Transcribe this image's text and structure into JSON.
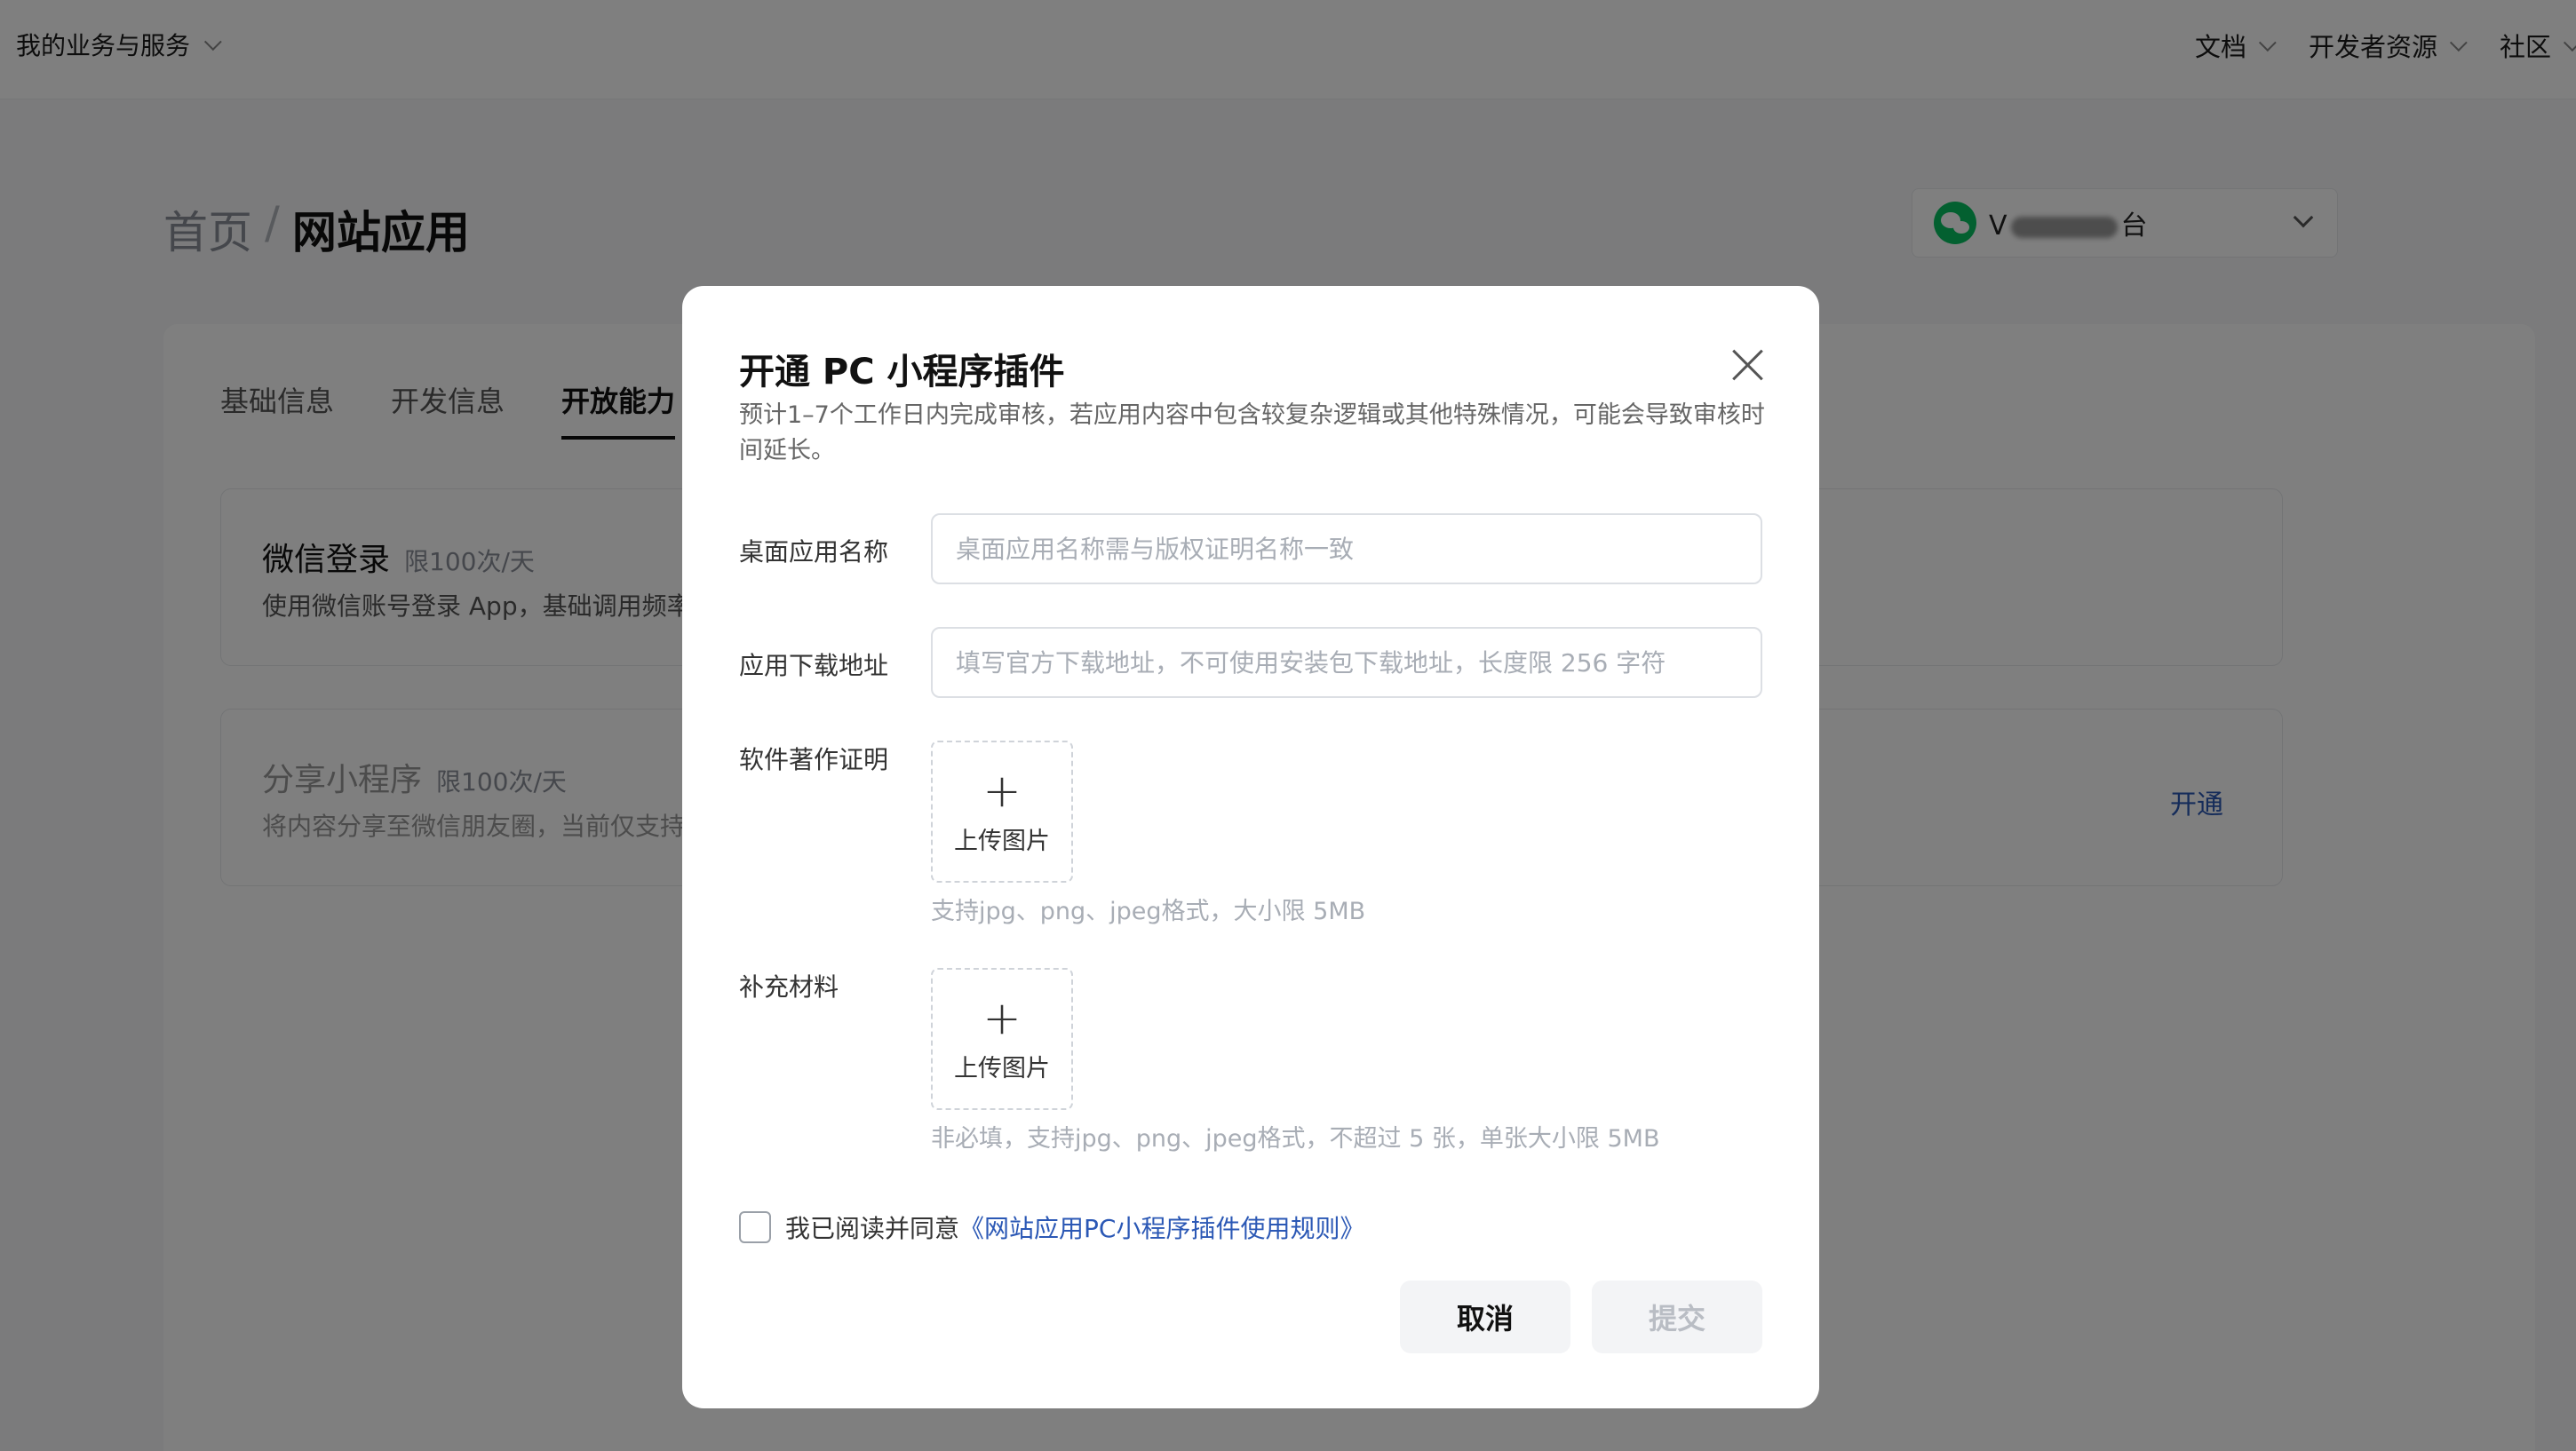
{
  "topbar": {
    "business": "我的业务与服务",
    "nav": [
      "文档",
      "开发者资源",
      "社区"
    ]
  },
  "breadcrumb": {
    "home": "首页",
    "separator": "/",
    "current": "网站应用"
  },
  "account": {
    "prefix": "V",
    "suffix": "台"
  },
  "tabs": [
    "基础信息",
    "开发信息",
    "开放能力"
  ],
  "cards": [
    {
      "title": "微信登录",
      "limit": "限100次/天",
      "desc": "使用微信账号登录 App，基础调用频率"
    },
    {
      "title": "分享小程序",
      "limit": "限100次/天",
      "desc": "将内容分享至微信朋友圈，当前仅支持",
      "action": "开通"
    }
  ],
  "modal": {
    "title": "开通 PC 小程序插件",
    "description": "预计1–7个工作日内完成审核，若应用内容中包含较复杂逻辑或其他特殊情况，可能会导致审核时间延长。",
    "fields": {
      "app_name": {
        "label": "桌面应用名称",
        "placeholder": "桌面应用名称需与版权证明名称一致",
        "value": ""
      },
      "download_url": {
        "label": "应用下载地址",
        "placeholder": "填写官方下载地址，不可使用安装包下载地址，长度限 256 字符",
        "value": ""
      },
      "copyright": {
        "label": "软件著作证明",
        "upload_label": "上传图片",
        "hint": "支持jpg、png、jpeg格式，大小限 5MB"
      },
      "supplement": {
        "label": "补充材料",
        "upload_label": "上传图片",
        "hint": "非必填，支持jpg、png、jpeg格式，不超过 5 张，单张大小限 5MB"
      }
    },
    "agreement": {
      "text": "我已阅读并同意",
      "link": "《网站应用PC小程序插件使用规则》",
      "checked": false
    },
    "buttons": {
      "cancel": "取消",
      "submit": "提交"
    }
  }
}
